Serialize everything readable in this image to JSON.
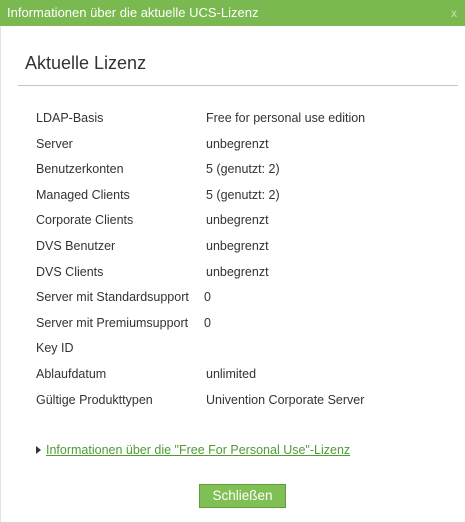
{
  "window": {
    "title": "Informationen über die aktuelle UCS-Lizenz",
    "close_glyph": "x"
  },
  "section": {
    "heading": "Aktuelle Lizenz"
  },
  "license": {
    "rows": [
      {
        "key": "LDAP-Basis",
        "value": "Free for personal use edition"
      },
      {
        "key": "Server",
        "value": "unbegrenzt"
      },
      {
        "key": "Benutzerkonten",
        "value": "5 (genutzt: 2)"
      },
      {
        "key": "Managed Clients",
        "value": "5 (genutzt: 2)"
      },
      {
        "key": "Corporate Clients",
        "value": "unbegrenzt"
      },
      {
        "key": "DVS Benutzer",
        "value": "unbegrenzt"
      },
      {
        "key": "DVS Clients",
        "value": "unbegrenzt"
      },
      {
        "key": "Server mit Standardsupport",
        "value": "0"
      },
      {
        "key": "Server mit Premiumsupport",
        "value": "0"
      },
      {
        "key": "Key ID",
        "value": ""
      },
      {
        "key": "Ablaufdatum",
        "value": "unlimited"
      },
      {
        "key": "Gültige Produkttypen",
        "value": "Univention Corporate Server"
      }
    ]
  },
  "info_link": {
    "icon": "triangle-right-icon",
    "label": "Informationen über die \"Free For Personal Use\"-Lizenz"
  },
  "footer": {
    "close_label": "Schließen"
  },
  "colors": {
    "titlebar": "#79b94f",
    "link": "#4d9c32",
    "button": "#7fbf53"
  }
}
